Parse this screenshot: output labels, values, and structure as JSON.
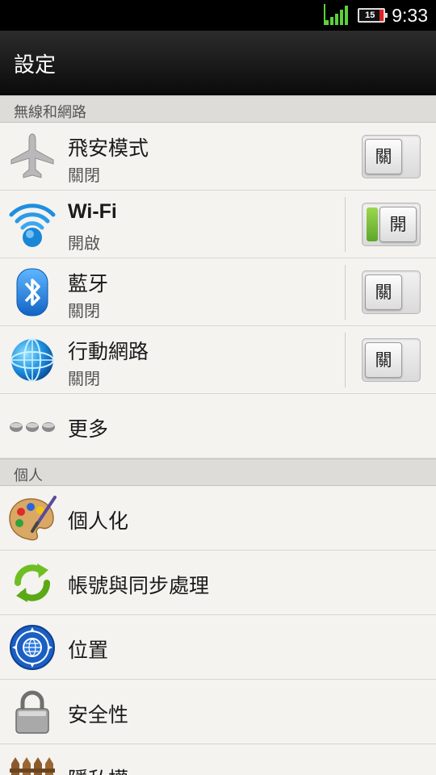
{
  "status_bar": {
    "time": "9:33",
    "battery_level": "15",
    "signal_icon": "signal-icon",
    "battery_icon": "battery-icon",
    "battery_color": "#e02020"
  },
  "header": {
    "title": "設定"
  },
  "sections": {
    "wireless": "無線和網路",
    "personal": "個人"
  },
  "wireless_items": [
    {
      "icon": "airplane-icon",
      "label": "飛安模式",
      "status": "關閉",
      "toggle": "關"
    },
    {
      "icon": "wifi-icon",
      "label": "Wi-Fi",
      "status": "開啟",
      "toggle": "開"
    },
    {
      "icon": "bluetooth-icon",
      "label": "藍牙",
      "status": "關閉",
      "toggle": "關"
    },
    {
      "icon": "mobile-network-icon",
      "label": "行動網路",
      "status": "關閉",
      "toggle": "關"
    },
    {
      "icon": "more-icon",
      "label": "更多"
    }
  ],
  "personal_items": [
    {
      "icon": "palette-icon",
      "label": "個人化"
    },
    {
      "icon": "sync-icon",
      "label": "帳號與同步處理"
    },
    {
      "icon": "location-icon",
      "label": "位置"
    },
    {
      "icon": "lock-icon",
      "label": "安全性"
    },
    {
      "icon": "privacy-fence-icon",
      "label": "隱私權"
    }
  ],
  "colors": {
    "toggle_on": "#6cb52f",
    "title_bar": "#1a1a1a",
    "background": "#f1f0ec"
  }
}
